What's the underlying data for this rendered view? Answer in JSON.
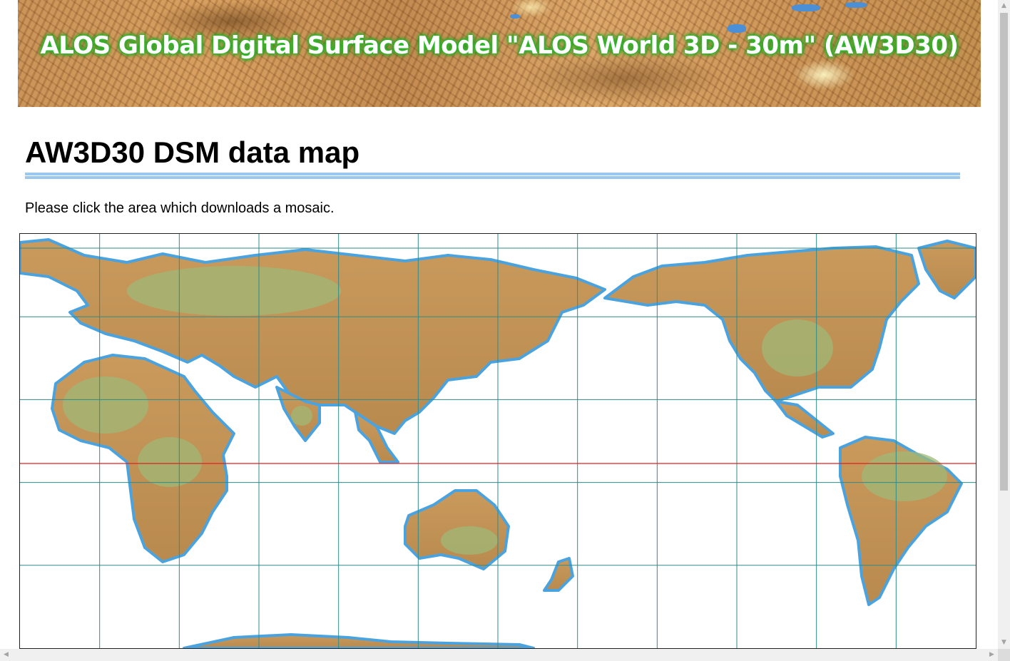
{
  "banner": {
    "title": "ALOS Global Digital Surface Model \"ALOS World 3D - 30m\" (AW3D30)"
  },
  "page": {
    "heading": "AW3D30 DSM data map",
    "instructions": "Please click the area which downloads a mosaic."
  },
  "map": {
    "grid_color": "#2e8b8b",
    "equator_color": "#e02020",
    "land_color": "#c9a060",
    "lowland_color": "#9fb877",
    "coast_color": "#4aa3df",
    "tile_columns": 12,
    "tile_rows": 5
  },
  "scrollbars": {
    "up_arrow": "▲",
    "down_arrow": "▼",
    "left_arrow": "◀",
    "right_arrow": "▶"
  }
}
